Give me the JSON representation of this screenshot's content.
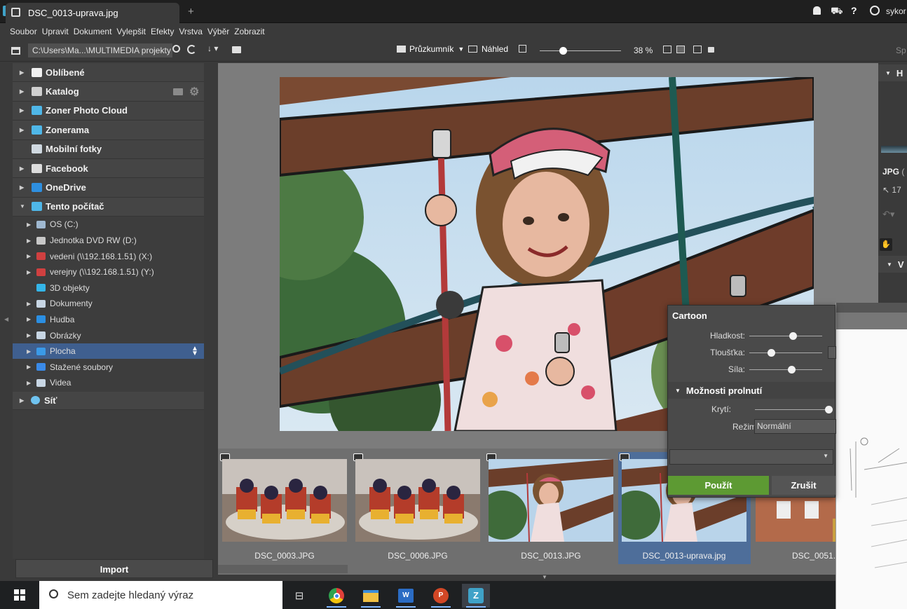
{
  "window": {
    "title": "DSC_0013-uprava.jpg",
    "new_tab_symbol": "+",
    "user": "sykor",
    "help_symbol": "?"
  },
  "menu": [
    "Soubor",
    "Upravit",
    "Dokument",
    "Vylepšit",
    "Efekty",
    "Vrstva",
    "Výběr",
    "Zobrazit"
  ],
  "toolbar": {
    "path": "C:\\Users\\Ma...\\MULTIMEDIA projekty",
    "sort_symbol": "↓",
    "browser_label": "Průzkumník",
    "preview_label": "Náhled",
    "zoom_percent": 38,
    "zoom_text": "38 %",
    "right_label": "Sp"
  },
  "nav": {
    "top": [
      {
        "label": "Oblíbené",
        "icon": "star-icon",
        "arrow": true
      },
      {
        "label": "Katalog",
        "icon": "catalog-icon",
        "arrow": true
      },
      {
        "label": "Zoner Photo Cloud",
        "icon": "cloud-icon",
        "arrow": true
      },
      {
        "label": "Zonerama",
        "icon": "zonerama-icon",
        "arrow": true
      },
      {
        "label": "Mobilní fotky",
        "icon": "phone-icon",
        "arrow": false
      },
      {
        "label": "Facebook",
        "icon": "facebook-icon",
        "arrow": true
      },
      {
        "label": "OneDrive",
        "icon": "onedrive-icon",
        "arrow": true
      },
      {
        "label": "Tento počítač",
        "icon": "computer-icon",
        "arrow": true,
        "expanded": true
      }
    ],
    "pc_items": [
      {
        "label": "OS (C:)",
        "icon": "drive-icon",
        "arrow": true
      },
      {
        "label": "Jednotka DVD RW (D:)",
        "icon": "dvd-icon",
        "arrow": true
      },
      {
        "label": "vedeni (\\\\192.168.1.51) (X:)",
        "icon": "network-drive-icon",
        "arrow": true
      },
      {
        "label": "verejny (\\\\192.168.1.51) (Y:)",
        "icon": "network-drive-icon",
        "arrow": true
      },
      {
        "label": "3D objekty",
        "icon": "cube-icon",
        "arrow": false
      },
      {
        "label": "Dokumenty",
        "icon": "documents-icon",
        "arrow": true
      },
      {
        "label": "Hudba",
        "icon": "music-icon",
        "arrow": true
      },
      {
        "label": "Obrázky",
        "icon": "pictures-icon",
        "arrow": true
      },
      {
        "label": "Plocha",
        "icon": "desktop-icon",
        "arrow": true,
        "selected": true
      },
      {
        "label": "Stažené soubory",
        "icon": "download-icon",
        "arrow": true
      },
      {
        "label": "Videa",
        "icon": "video-icon",
        "arrow": true
      }
    ],
    "network": {
      "label": "Síť",
      "icon": "network-icon"
    }
  },
  "import_label": "Import",
  "filmstrip": [
    {
      "name": "DSC_0003.JPG",
      "scene": "dessert"
    },
    {
      "name": "DSC_0006.JPG",
      "scene": "dessert"
    },
    {
      "name": "DSC_0013.JPG",
      "scene": "playground"
    },
    {
      "name": "DSC_0013-uprava.jpg",
      "scene": "playground",
      "selected": true
    },
    {
      "name": "DSC_0051.JPG",
      "scene": "house"
    }
  ],
  "right_panel": {
    "histogram_label": "H",
    "format": "JPG",
    "format_rest": "(",
    "coords_partial": "17",
    "section2_label": "V"
  },
  "cartoon": {
    "title": "Cartoon",
    "sliders": [
      {
        "label": "Hladkost:",
        "value": 0.6
      },
      {
        "label": "Tloušťka:",
        "value": 0.3
      },
      {
        "label": "Síla:",
        "value": 0.58
      }
    ],
    "blend_section": "Možnosti prolnutí",
    "opacity_label": "Krytí:",
    "opacity_value": 1.0,
    "mode_label": "Režim:",
    "mode_value": "Normální",
    "apply_label": "Použít",
    "cancel_label": "Zrušit"
  },
  "taskbar": {
    "search_placeholder": "Sem zadejte hledaný výraz",
    "apps": [
      "task-view",
      "chrome",
      "file-explorer",
      "word",
      "powerpoint",
      "zoner"
    ]
  }
}
